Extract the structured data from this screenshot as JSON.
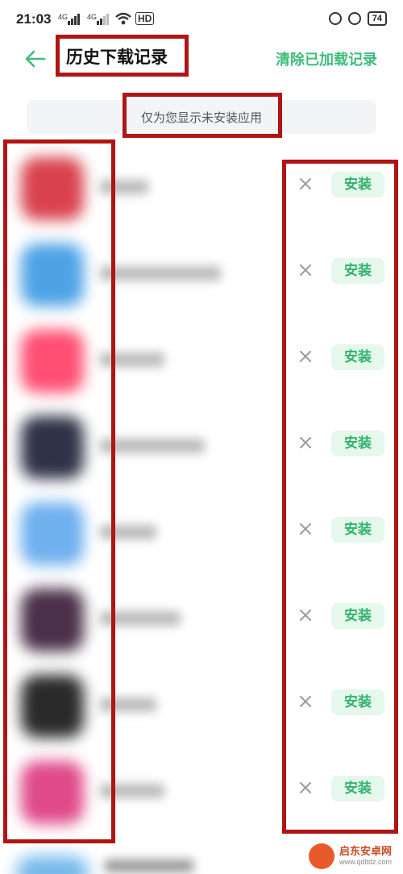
{
  "status": {
    "time": "21:03",
    "signal_left_1": "4G",
    "signal_left_2": "4G",
    "hd": "HD",
    "battery": "74"
  },
  "header": {
    "title": "历史下载记录",
    "clear_label": "清除已加载记录"
  },
  "notice": "仅为您显示未安装应用",
  "apps": [
    {
      "install": "安装",
      "icon_color": "#d9424d"
    },
    {
      "install": "安装",
      "icon_color": "#4ea3e6"
    },
    {
      "install": "安装",
      "icon_color": "#ff4f73"
    },
    {
      "install": "安装",
      "icon_color": "#2f3347"
    },
    {
      "install": "安装",
      "icon_color": "#6fb0ef"
    },
    {
      "install": "安装",
      "icon_color": "#4a3048"
    },
    {
      "install": "安装",
      "icon_color": "#2a2a2a"
    },
    {
      "install": "安装",
      "icon_color": "#e04a8a"
    }
  ],
  "watermark": {
    "name": "启东安卓网",
    "url": "www.qdltdz.com"
  }
}
